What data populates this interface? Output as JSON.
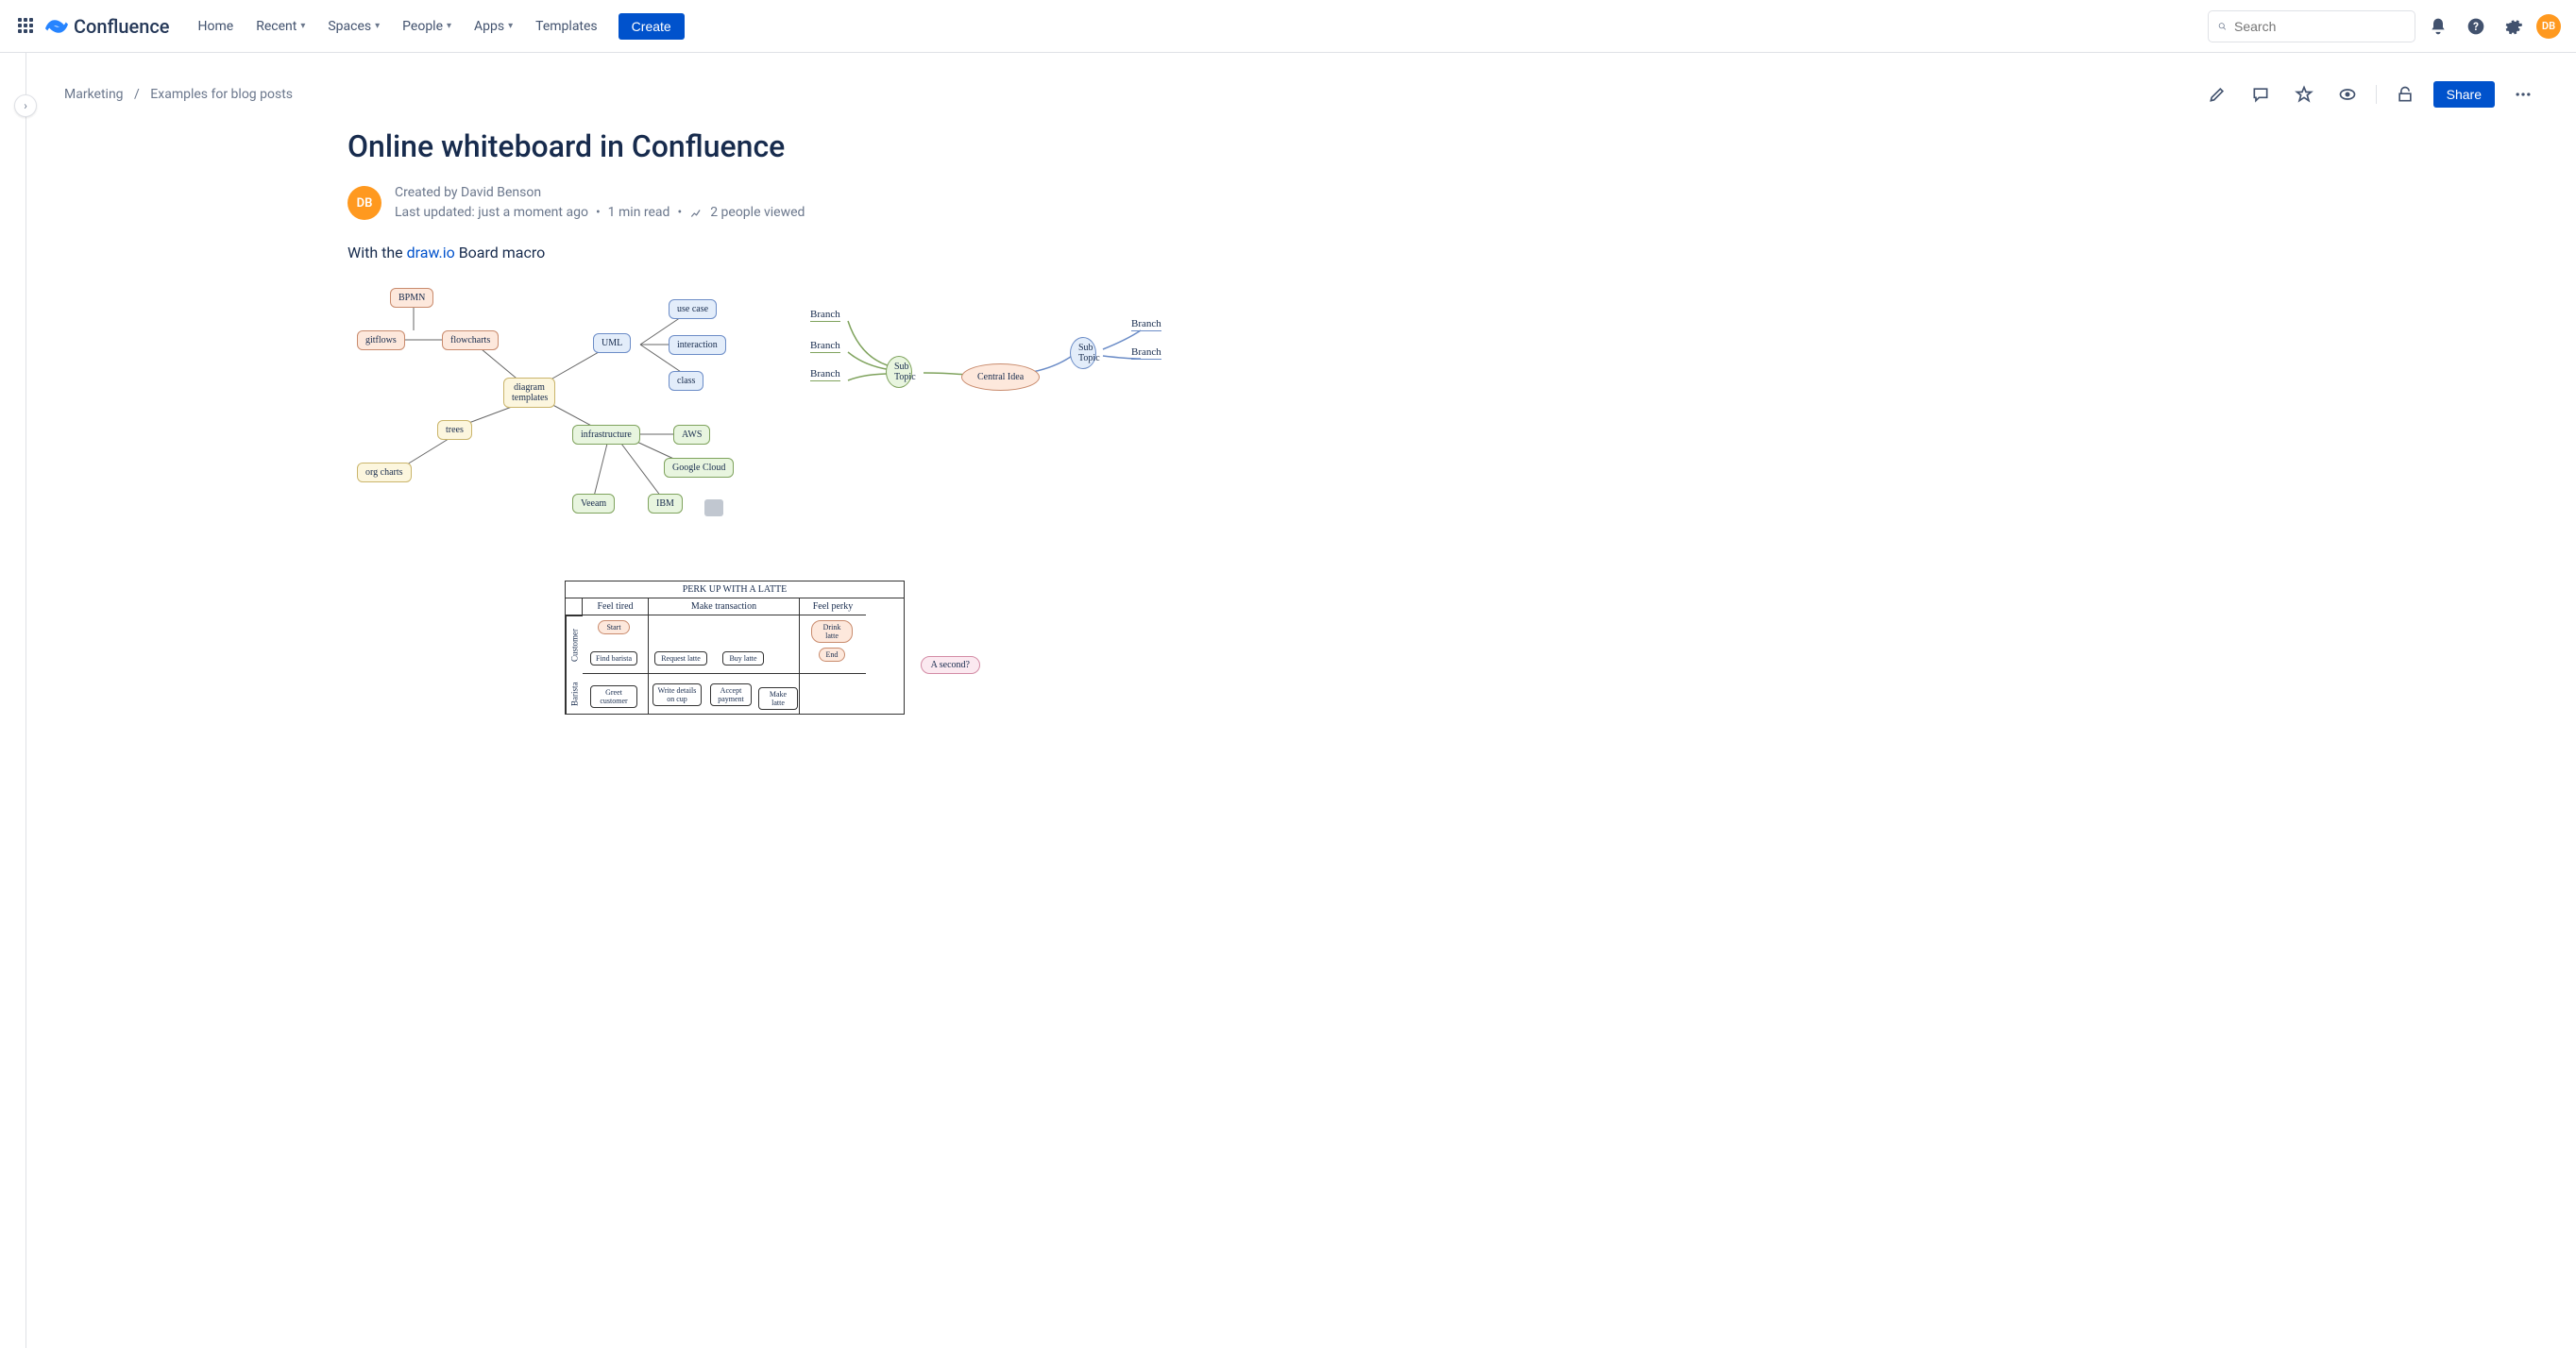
{
  "brand": "Confluence",
  "nav": {
    "home": "Home",
    "recent": "Recent",
    "spaces": "Spaces",
    "people": "People",
    "apps": "Apps",
    "templates": "Templates",
    "create": "Create"
  },
  "search": {
    "placeholder": "Search"
  },
  "user": {
    "initials": "DB"
  },
  "breadcrumb": {
    "space": "Marketing",
    "parent": "Examples for blog posts"
  },
  "actions": {
    "share": "Share"
  },
  "page": {
    "title": "Online whiteboard in Confluence",
    "author_initials": "DB",
    "created_by": "Created by David Benson",
    "last_updated": "Last updated: just a moment ago",
    "read_time": "1 min read",
    "viewers": "2 people viewed",
    "intro_prefix": "With the ",
    "intro_link": "draw.io",
    "intro_suffix": " Board macro"
  },
  "mindmap1": {
    "center": "diagram templates",
    "bpmn": "BPMN",
    "gitflows": "gitflows",
    "flowcharts": "flowcharts",
    "trees": "trees",
    "orgcharts": "org charts",
    "uml": "UML",
    "usecase": "use case",
    "interaction": "interaction",
    "class": "class",
    "infra": "infrastructure",
    "aws": "AWS",
    "gcloud": "Google Cloud",
    "veeam": "Veeam",
    "ibm": "IBM"
  },
  "mindmap2": {
    "central": "Central Idea",
    "sub_left": "Sub Topic",
    "sub_right": "Sub Topic",
    "branch": "Branch"
  },
  "swimlane": {
    "title": "Perk up with a latte",
    "phase1": "Feel tired",
    "phase2": "Make transaction",
    "phase3": "Feel perky",
    "lane_customer": "Customer",
    "lane_barista": "Barista",
    "start": "Start",
    "find_barista": "Find barista",
    "request_latte": "Request latte",
    "buy_latte": "Buy latte",
    "drink_latte": "Drink latte",
    "end": "End",
    "greet": "Greet customer",
    "write_details": "Write details on cup",
    "accept_payment": "Accept payment",
    "make_latte": "Make latte",
    "annotation": "A second?"
  }
}
